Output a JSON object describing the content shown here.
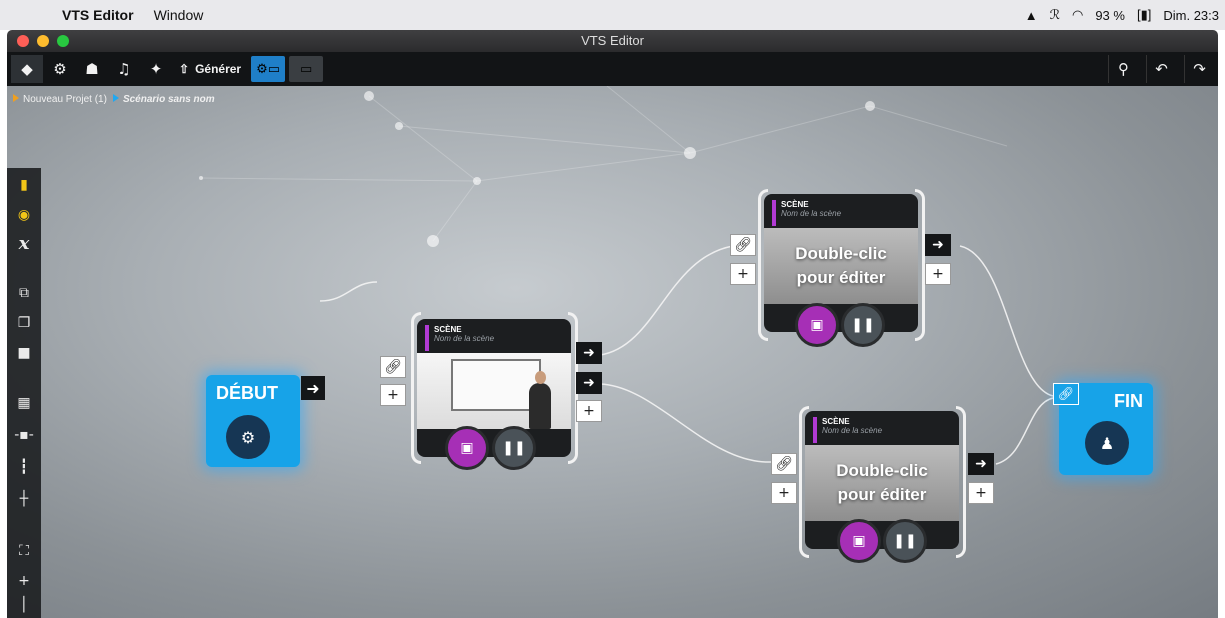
{
  "menubar": {
    "apple": "",
    "app_name": "VTS Editor",
    "menu_window": "Window",
    "battery": "93 %",
    "clock": "Dim. 23:3"
  },
  "window": {
    "title": "VTS Editor"
  },
  "toolbar": {
    "generate_label": "Générer",
    "icons": [
      "gem-icon",
      "gears-icon",
      "character-icon",
      "media-icon",
      "sparkle-icon",
      "upload-icon",
      "scenario-view-icon",
      "image-view-icon",
      "search-icon",
      "undo-icon",
      "redo-icon"
    ]
  },
  "breadcrumb": {
    "project": "Nouveau Projet (1)",
    "scenario": "Scénario sans nom"
  },
  "sidebar": {
    "variable_label": "x"
  },
  "nodes": {
    "start": {
      "label": "DÉBUT"
    },
    "end": {
      "label": "FIN"
    },
    "scene1": {
      "title": "SCÈNE",
      "subtitle": "Nom de la scène"
    },
    "scene2": {
      "title": "SCÈNE",
      "subtitle": "Nom de la scène",
      "overlay": "Double-clic pour éditer"
    },
    "scene3": {
      "title": "SCÈNE",
      "subtitle": "Nom de la scène",
      "overlay": "Double-clic pour éditer"
    }
  },
  "ports": {
    "plus": "+",
    "arrow": "➜"
  },
  "colors": {
    "accent_blue": "#17a3e8",
    "media_purple": "#a62fb6",
    "toolbar_bg": "#121416"
  }
}
